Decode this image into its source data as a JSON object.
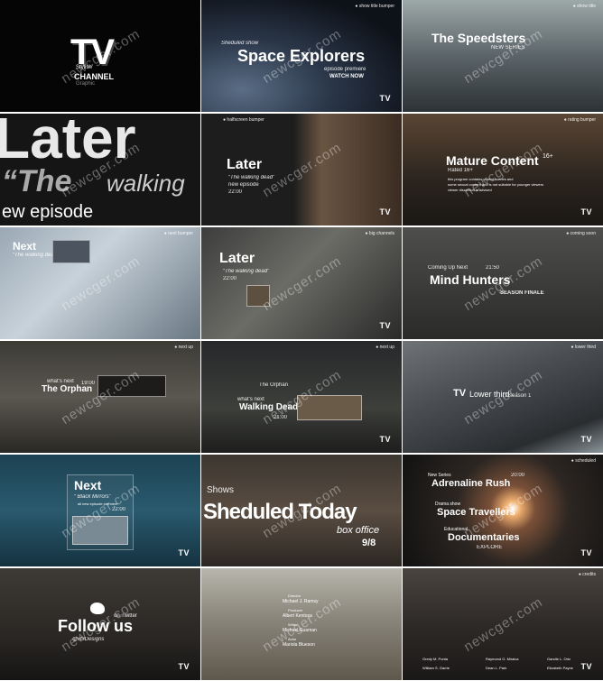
{
  "watermark": "newcger.com",
  "tv_logo": "TV",
  "tiles": {
    "t1": {
      "logo_main": "TV",
      "logo_sub1": "Stylish",
      "logo_sub2": "CHANNEL",
      "logo_sub3": "Graphic"
    },
    "t2": {
      "tag": "● show title bumper",
      "kicker": "Sheduled show",
      "title": "Space Explorers",
      "line": "episode premiere",
      "cta": "WATCH NOW"
    },
    "t3": {
      "tag": "● show title",
      "title": "The Speedsters",
      "sub": "NEW SERIES"
    },
    "t4": {
      "big1": "Later",
      "big2": "“The",
      "big3": "walking",
      "big4": "ew episode"
    },
    "t5": {
      "tag": "● halfscreen bumper",
      "title": "Later",
      "sub": "“The walking dead”",
      "line": "new episode",
      "time": "22:00"
    },
    "t6": {
      "tag": "● rating bumper",
      "title": "Mature Content",
      "rating_sup": "16+",
      "rated": "Rated 16+",
      "desc1": "this program contains violent scenes and",
      "desc2": "some sexual content and is not suitable for younger viewers",
      "desc3": "viewer discretion is advised"
    },
    "t7": {
      "title": "Next",
      "sub": "“The walking dead”",
      "tag": "● next bumper"
    },
    "t8": {
      "tag": "● big channels",
      "title": "Later",
      "sub": "“The walking dead”",
      "time": "22:00"
    },
    "t9": {
      "tag": "● coming soon",
      "kicker": "Coming Up Next",
      "time": "21:50",
      "title": "Mind Hunters",
      "sub": "SEASON FINALE"
    },
    "t10": {
      "tag": "● next up",
      "kicker": "what's next",
      "title": "The Orphan",
      "time": "19:00"
    },
    "t11": {
      "tag": "● next up",
      "line1": "The Orphan",
      "kicker": "what's next",
      "title": "Walking Dead",
      "time": "21:00"
    },
    "t12": {
      "tag": "● lower third",
      "title": "TV",
      "sub": "Lower third",
      "sub2": "season 1"
    },
    "t13": {
      "title": "Next",
      "sub": "“ Black Mirrors”",
      "line": "all new episode premiere",
      "time": "22:00"
    },
    "t14": {
      "l1": "Sheduled Today",
      "l2": "box office",
      "l3": "9/8",
      "l4": "Shows"
    },
    "t15": {
      "tag": "● scheduled",
      "kicker1": "New Series",
      "t1": "Adrenaline Rush",
      "time1": "20:00",
      "kicker2": "Drama show",
      "t2": "Space Travellers",
      "kicker3": "Educational",
      "t3": "Documentaries",
      "sub3": "EXPLORE"
    },
    "t16": {
      "handle": "@xfxDesigns",
      "title": "Follow us",
      "sub": "on Twitter"
    },
    "t17": {
      "c1": "Director",
      "n1": "Michael J. Ramsy",
      "c2": "Producer",
      "n2": "Albert Kentoza",
      "c3": "Writer",
      "n3": "Michael Guaman",
      "c4": "Actor",
      "n4": "Mariola Blueson"
    },
    "t18": {
      "tag": "● credits",
      "c1": "Gredy M. Ponta",
      "c2": "Raymond G. Miralca",
      "c3": "Gandle L. Ortz",
      "c4": "William S. Garrie",
      "c5": "Dean L. Park",
      "c6": "Elizabeth Payne"
    }
  }
}
